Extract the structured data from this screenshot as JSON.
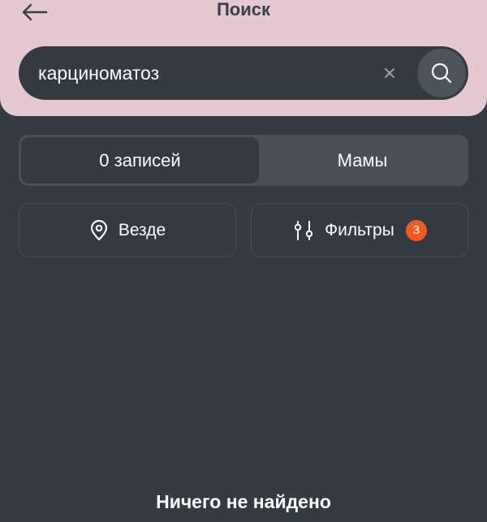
{
  "header": {
    "title": "Поиск",
    "back_icon": "arrow-left-icon",
    "background": "#e6c8d3"
  },
  "search": {
    "value": "карциноматоз",
    "clear_icon": "close-icon",
    "submit_icon": "search-icon"
  },
  "segment": {
    "tabs": [
      {
        "label": "0 записей",
        "active": true
      },
      {
        "label": "Мамы",
        "active": false
      }
    ]
  },
  "chips": {
    "location": {
      "label": "Везде",
      "icon": "location-pin-icon"
    },
    "filters": {
      "label": "Фильтры",
      "icon": "sliders-icon",
      "badge": "3",
      "badge_color": "#f35a1f"
    }
  },
  "empty_state": {
    "message": "Ничего не найдено"
  }
}
